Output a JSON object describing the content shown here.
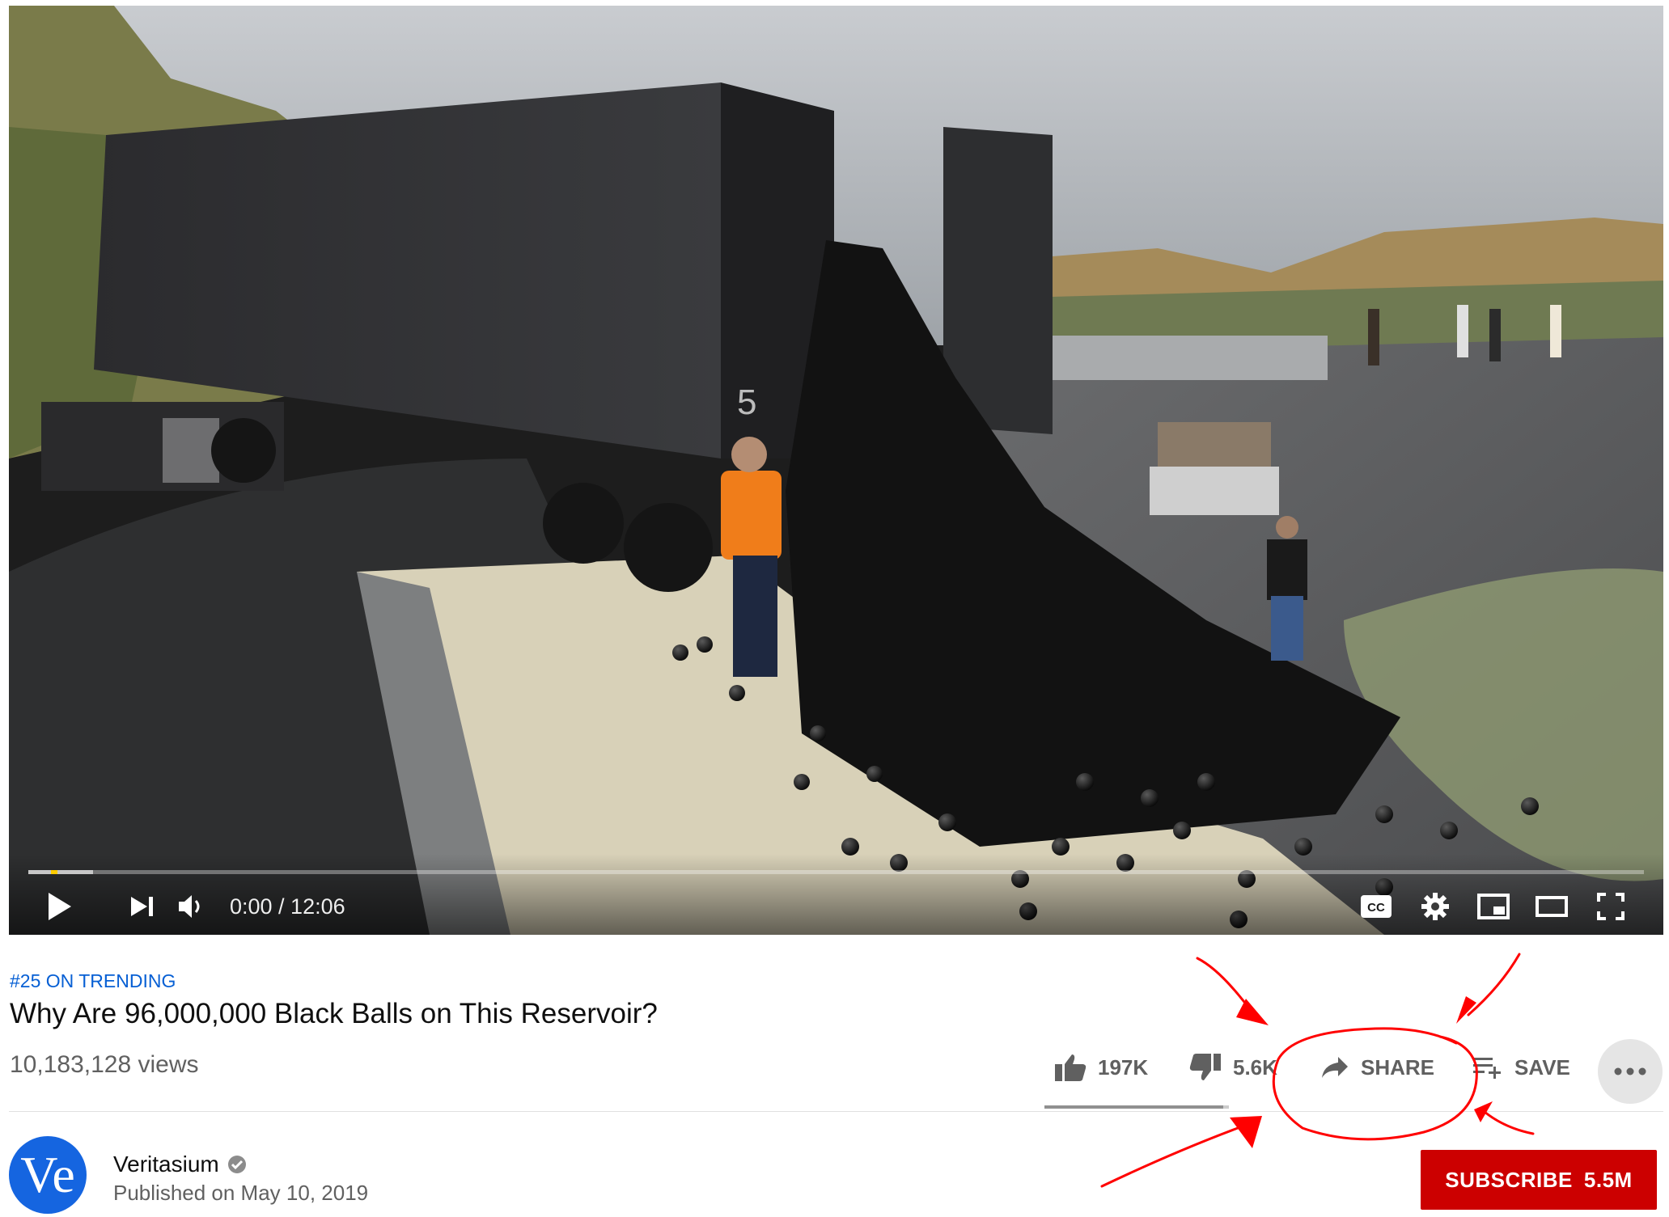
{
  "player": {
    "time_display": "0:00 / 12:06",
    "progress_fraction": 0.0,
    "buffered_fraction": 0.04,
    "container_number": "5",
    "controls": [
      "play-icon",
      "next-icon",
      "volume-icon",
      "captions-icon",
      "settings-icon",
      "miniplayer-icon",
      "theater-icon",
      "fullscreen-icon"
    ],
    "captions_label": "CC"
  },
  "video": {
    "trending_label": "#25 ON TRENDING",
    "title": "Why Are 96,000,000 Black Balls on This Reservoir?",
    "views": "10,183,128 views"
  },
  "actions": {
    "like_count": "197K",
    "dislike_count": "5.6K",
    "share_label": "SHARE",
    "save_label": "SAVE",
    "like_fraction": 0.97
  },
  "channel": {
    "avatar_text": "Ve",
    "name": "Veritasium",
    "verified": true,
    "published": "Published on May 10, 2019"
  },
  "subscribe": {
    "label": "SUBSCRIBE",
    "count": "5.5M"
  },
  "colors": {
    "accent_blue": "#065fd4",
    "subscribe_red": "#cc0000",
    "annotation_red": "#ff0000"
  }
}
